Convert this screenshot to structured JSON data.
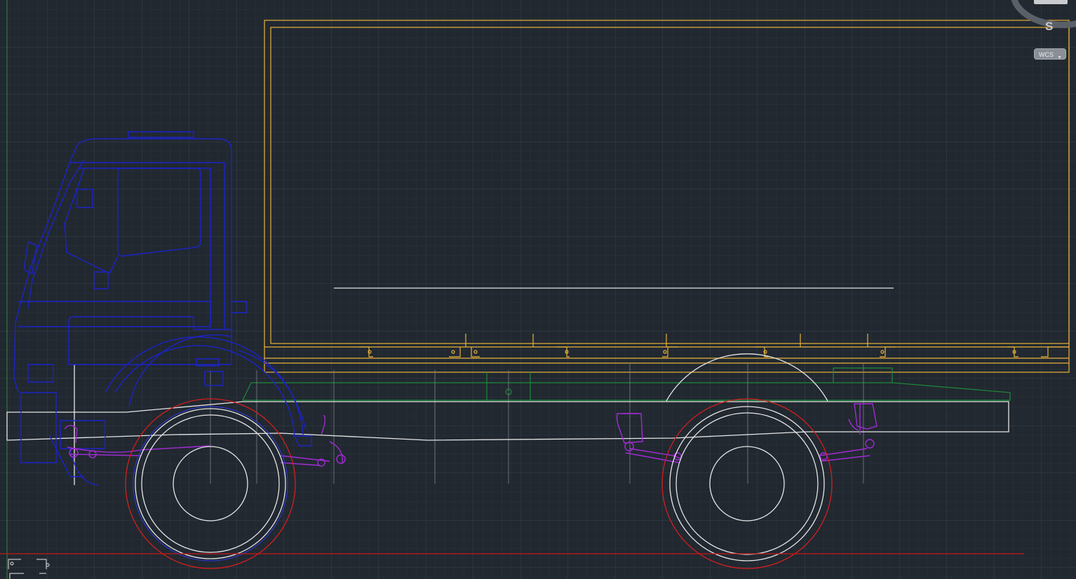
{
  "viewcube": {
    "compass_label": "S"
  },
  "coordinate_system": {
    "label": "WCS"
  },
  "colors": {
    "background": "#212830",
    "grid_minor": "#2b333d",
    "grid_major": "#37414c",
    "cargo_box": "#e8b23a",
    "cab": "#1c23c8",
    "chassis": "#e6e6e6",
    "subframe": "#1e8a3a",
    "suspension": "#a22bd6",
    "tire_outline": "#d41e1e",
    "ground_line": "#c41818",
    "y_axis": "#2f8a3a"
  },
  "icons": [
    "viewcube-icon",
    "ucs-icon",
    "chevron-down-icon"
  ]
}
